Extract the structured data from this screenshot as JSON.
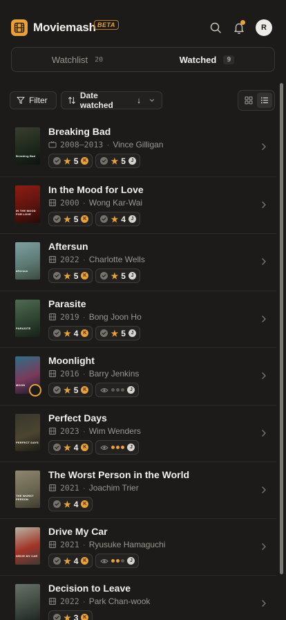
{
  "app": {
    "name": "Moviemash",
    "badge": "BETA",
    "avatar_initial": "R"
  },
  "icons": {
    "logo": "film-icon",
    "search": "search-icon",
    "notifications": "bell-icon"
  },
  "colors": {
    "accent": "#e9a23b",
    "background": "#1c1b1a",
    "surface": "#232220"
  },
  "tabs": [
    {
      "label": "Watchlist",
      "count": "20",
      "active": false
    },
    {
      "label": "Watched",
      "count": "9",
      "active": true
    }
  ],
  "toolbar": {
    "filter_label": "Filter",
    "sort_label": "Date watched",
    "sort_direction": "↓",
    "view_mode": "list"
  },
  "movies": [
    {
      "title": "Breaking Bad",
      "type": "tv",
      "year": "2008–2013",
      "creator": "Vince Gilligan",
      "ratings": [
        {
          "status": "watched",
          "stars": "5",
          "user": "K"
        },
        {
          "status": "watched",
          "stars": "5",
          "user": "J"
        }
      ]
    },
    {
      "title": "In the Mood for Love",
      "type": "film",
      "year": "2000",
      "creator": "Wong Kar-Wai",
      "ratings": [
        {
          "status": "watched",
          "stars": "5",
          "user": "K"
        },
        {
          "status": "watched",
          "stars": "4",
          "user": "J"
        }
      ]
    },
    {
      "title": "Aftersun",
      "type": "film",
      "year": "2022",
      "creator": "Charlotte Wells",
      "ratings": [
        {
          "status": "watched",
          "stars": "5",
          "user": "K"
        },
        {
          "status": "watched",
          "stars": "5",
          "user": "J"
        }
      ]
    },
    {
      "title": "Parasite",
      "type": "film",
      "year": "2019",
      "creator": "Bong Joon Ho",
      "ratings": [
        {
          "status": "watched",
          "stars": "4",
          "user": "K"
        },
        {
          "status": "watched",
          "stars": "5",
          "user": "J"
        }
      ]
    },
    {
      "title": "Moonlight",
      "type": "film",
      "year": "2016",
      "creator": "Barry Jenkins",
      "ratings": [
        {
          "status": "watched",
          "stars": "5",
          "user": "K"
        },
        {
          "status": "seen",
          "progress": 0,
          "user": "J"
        }
      ]
    },
    {
      "title": "Perfect Days",
      "type": "film",
      "year": "2023",
      "creator": "Wim Wenders",
      "ratings": [
        {
          "status": "watched",
          "stars": "4",
          "user": "K"
        },
        {
          "status": "seen",
          "progress": 3,
          "user": "J"
        }
      ]
    },
    {
      "title": "The Worst Person in the World",
      "type": "film",
      "year": "2021",
      "creator": "Joachim Trier",
      "ratings": [
        {
          "status": "watched",
          "stars": "4",
          "user": "K"
        }
      ]
    },
    {
      "title": "Drive My Car",
      "type": "film",
      "year": "2021",
      "creator": "Ryusuke Hamaguchi",
      "ratings": [
        {
          "status": "watched",
          "stars": "4",
          "user": "K"
        },
        {
          "status": "seen",
          "progress": 2,
          "user": "J"
        }
      ]
    },
    {
      "title": "Decision to Leave",
      "type": "film",
      "year": "2022",
      "creator": "Park Chan-wook",
      "ratings": [
        {
          "status": "watched",
          "stars": "3",
          "user": "K"
        }
      ]
    }
  ],
  "posters": [
    {
      "caption": "Breaking Bad",
      "colors": [
        "#3a3e30",
        "#1d2a1c",
        "#0e1410"
      ]
    },
    {
      "caption": "IN THE MOOD FOR LOVE",
      "colors": [
        "#8c1e14",
        "#5e140e",
        "#2a0b08"
      ]
    },
    {
      "caption": "aftersun",
      "colors": [
        "#7e9fa2",
        "#5d7a74",
        "#3c4b3e"
      ]
    },
    {
      "caption": "PARASITE",
      "colors": [
        "#4f6b52",
        "#2f4432",
        "#172019"
      ]
    },
    {
      "caption": "MOON",
      "colors": [
        "#2e6f86",
        "#7a3a5c",
        "#1c1a2c"
      ]
    },
    {
      "caption": "PERFECT DAYS",
      "colors": [
        "#38362c",
        "#4b4530",
        "#1d1b15"
      ]
    },
    {
      "caption": "THE WORST PERSON",
      "colors": [
        "#8e8670",
        "#6a6550",
        "#3f3b2e"
      ]
    },
    {
      "caption": "DRIVE MY CAR",
      "colors": [
        "#b8b3a5",
        "#a13427",
        "#3e3a36"
      ]
    },
    {
      "caption": "",
      "colors": [
        "#68726a",
        "#3f4a42",
        "#1e2420"
      ]
    }
  ]
}
